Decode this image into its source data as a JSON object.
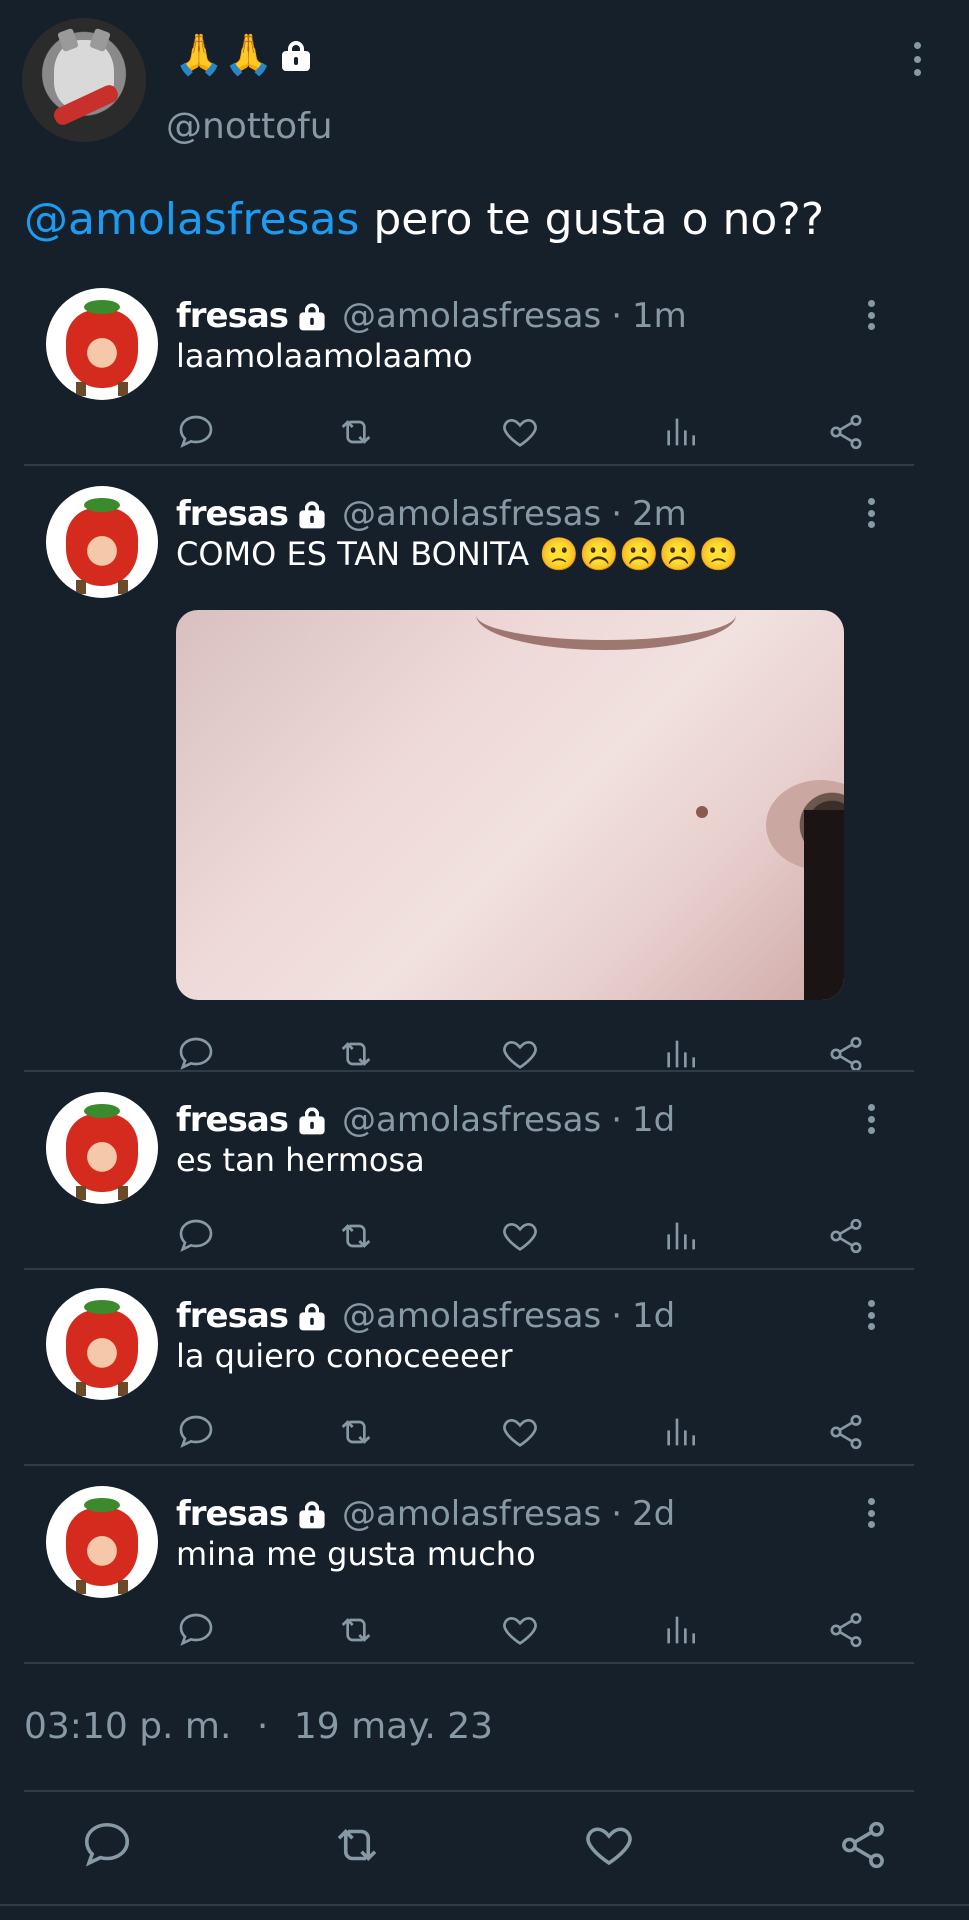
{
  "main_tweet": {
    "display_name": "🙏🙏",
    "handle": "@nottofu",
    "mention": "@amolasfresas",
    "text": " pero te gusta o no??",
    "timestamp": "03:10 p. m.",
    "separator": "·",
    "date": "19 may. 23"
  },
  "replies": [
    {
      "name": "fresas",
      "handle": "@amolasfresas",
      "time": "1m",
      "text": "laamolaamolaamo"
    },
    {
      "name": "fresas",
      "handle": "@amolasfresas",
      "time": "2m",
      "text": "COMO ES TAN BONITA 🙁☹️☹️☹️🙁",
      "has_image": true
    },
    {
      "name": "fresas",
      "handle": "@amolasfresas",
      "time": "1d",
      "text": "es tan hermosa"
    },
    {
      "name": "fresas",
      "handle": "@amolasfresas",
      "time": "1d",
      "text": "la quiero conoceeeer"
    },
    {
      "name": "fresas",
      "handle": "@amolasfresas",
      "time": "2d",
      "text": "mina me gusta mucho"
    }
  ],
  "meta_separator": "·",
  "icons": [
    "reply-icon",
    "retweet-icon",
    "like-icon",
    "analytics-icon",
    "share-icon",
    "lock-icon",
    "more-icon"
  ],
  "colors": {
    "background": "#15202b",
    "accent": "#1d9bf0",
    "muted": "#8899a6"
  }
}
